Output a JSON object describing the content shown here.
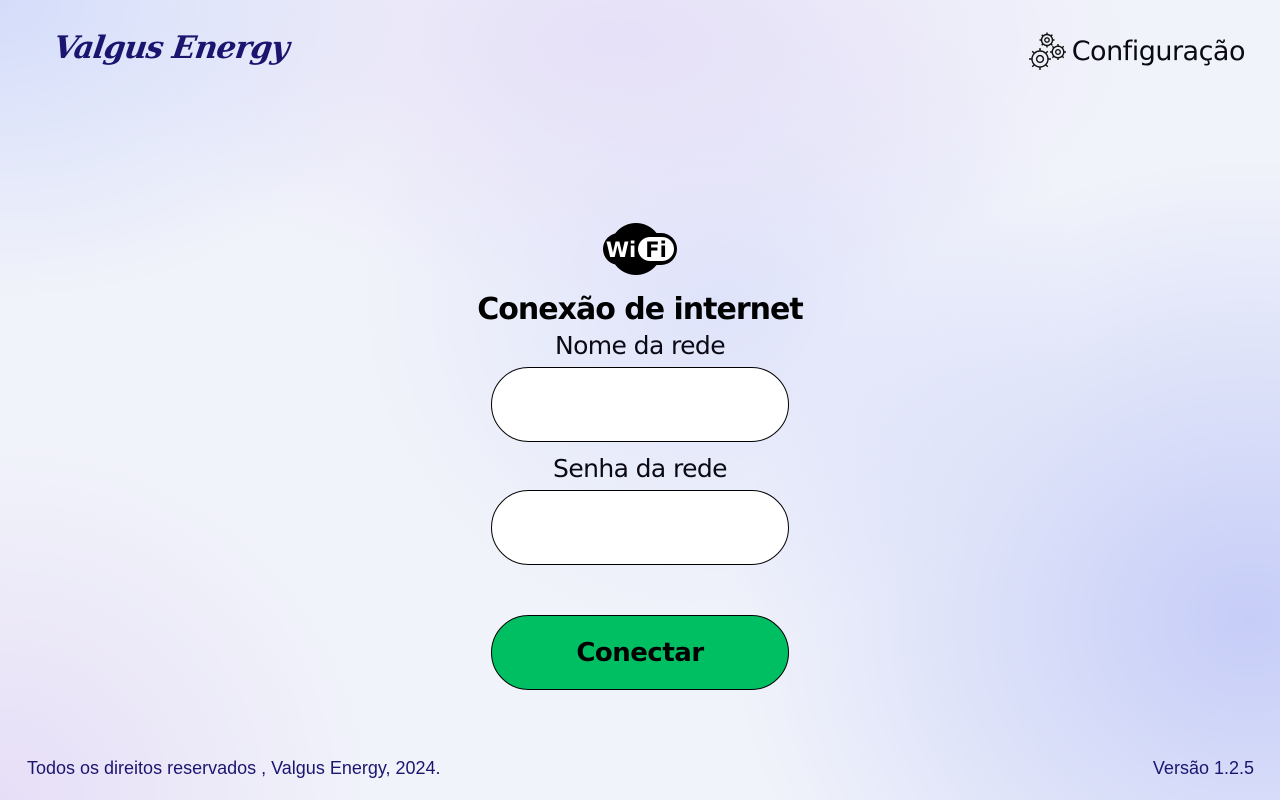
{
  "brand": {
    "logo_text": "Valgus Energy",
    "color": "#1b1570"
  },
  "header": {
    "config_label": "Configuração",
    "config_icon": "gears-icon"
  },
  "main": {
    "icon": "wifi-icon",
    "icon_text_left": "Wi",
    "icon_text_right": "Fi",
    "title": "Conexão de internet",
    "network_name_label": "Nome da rede",
    "network_name_value": "",
    "network_password_label": "Senha da rede",
    "network_password_value": "",
    "connect_label": "Conectar",
    "connect_color": "#00bf63"
  },
  "footer": {
    "copyright": "Todos os direitos reservados , Valgus Energy, 2024.",
    "version": "Versão 1.2.5"
  }
}
